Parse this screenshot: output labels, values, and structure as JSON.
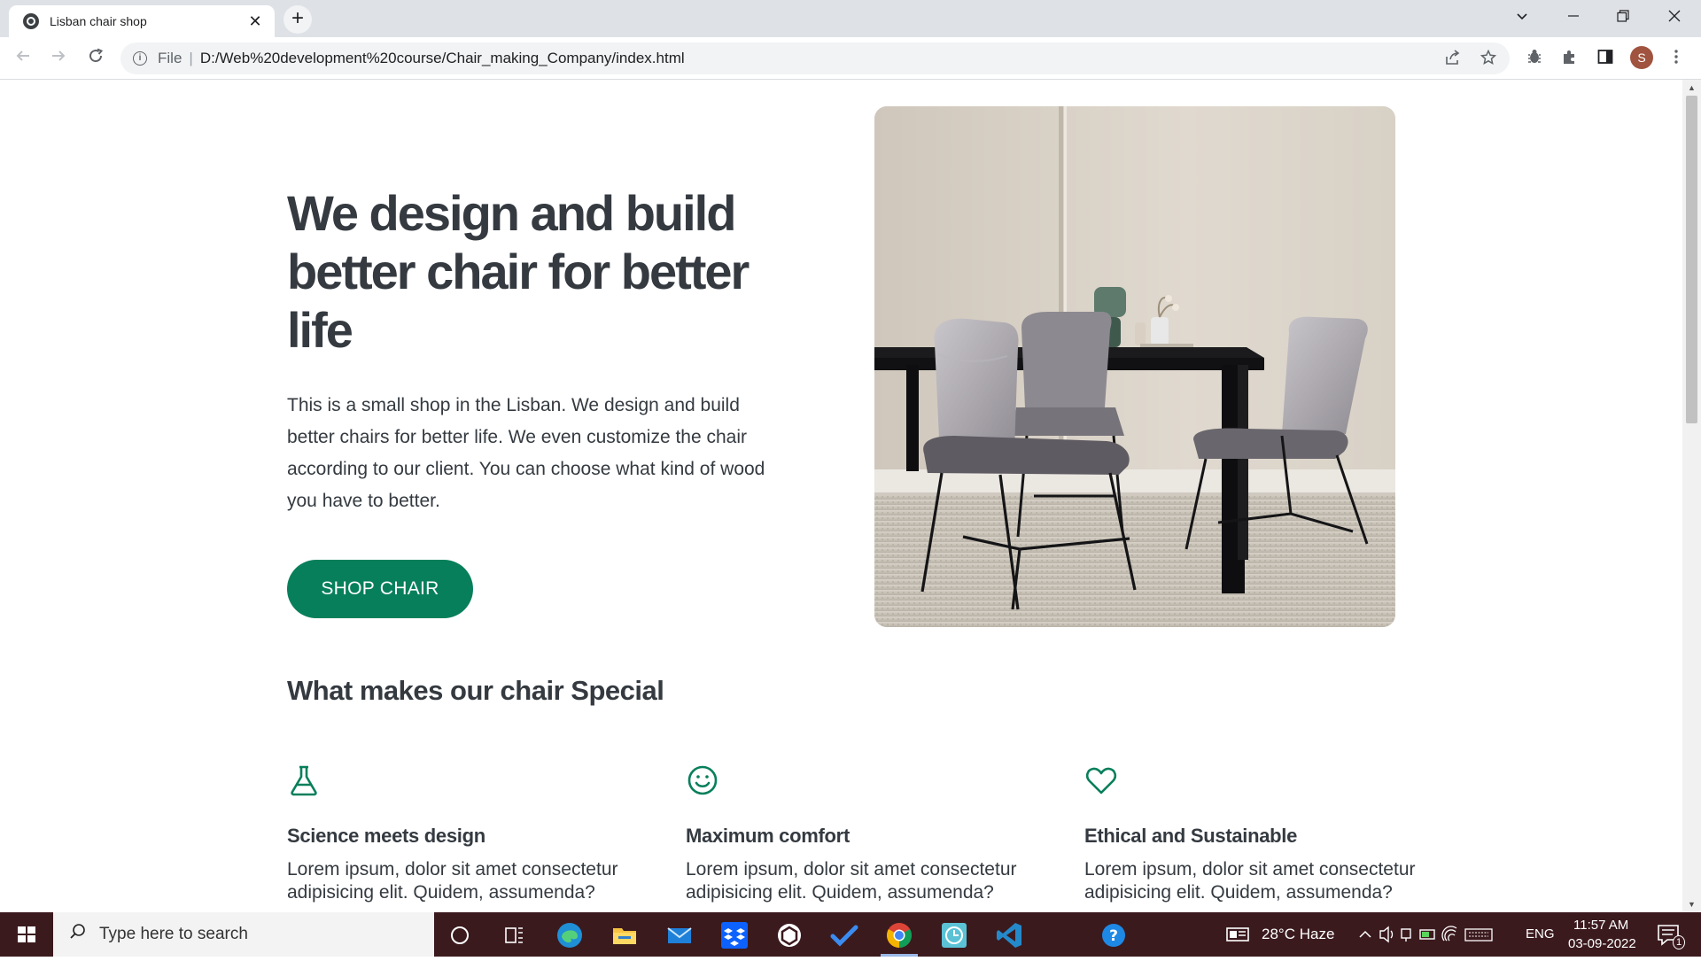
{
  "browser": {
    "tab_title": "Lisban chair shop",
    "tab_close": "✕",
    "new_tab": "+",
    "omnibox_scheme": "File",
    "omnibox_sep": "|",
    "url": "D:/Web%20development%20course/Chair_making_Company/index.html",
    "profile_initial": "S"
  },
  "hero": {
    "title": "We design and build better chair for better life",
    "description": "This is a small shop in the Lisban. We design and build better chairs for better life. We even customize the chair according to our client. You can choose what kind of wood you have to better.",
    "cta_label": "SHOP CHAIR"
  },
  "features_section": {
    "title": "What makes our chair Special",
    "items": [
      {
        "icon": "flask-icon",
        "title": "Science meets design",
        "text": "Lorem ipsum, dolor sit amet consectetur adipisicing elit. Quidem, assumenda?"
      },
      {
        "icon": "smile-icon",
        "title": "Maximum comfort",
        "text": "Lorem ipsum, dolor sit amet consectetur adipisicing elit. Quidem, assumenda?"
      },
      {
        "icon": "heart-icon",
        "title": "Ethical and Sustainable",
        "text": "Lorem ipsum, dolor sit amet consectetur adipisicing elit. Quidem, assumenda?"
      }
    ]
  },
  "colors": {
    "accent": "#087f5b",
    "text": "#343a40",
    "taskbar": "#3b1a1e"
  },
  "taskbar": {
    "search_placeholder": "Type here to search",
    "weather": "28°C  Haze",
    "language": "ENG",
    "time": "11:57 AM",
    "date": "03-09-2022",
    "notification_count": "1"
  }
}
